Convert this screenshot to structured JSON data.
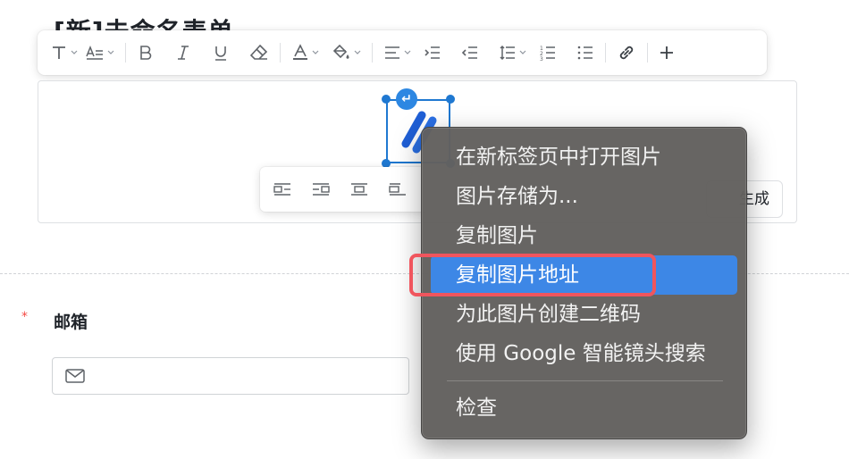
{
  "page": {
    "title": "[新]未命名表单"
  },
  "toolbar": {
    "icons": [
      "text-style-icon",
      "paragraph-style-icon",
      "bold-icon",
      "italic-icon",
      "underline-icon",
      "eraser-icon",
      "font-color-icon",
      "fill-color-icon",
      "align-icon",
      "indent-icon",
      "outdent-icon",
      "line-height-icon",
      "ordered-list-icon",
      "bullet-list-icon",
      "link-icon",
      "plus-icon"
    ]
  },
  "image_align_bar": {
    "icons": [
      "align-left-icon",
      "align-right-icon",
      "align-center-icon",
      "align-inline-icon"
    ]
  },
  "editor": {
    "partial_button_label": "生成"
  },
  "context_menu": {
    "items": [
      {
        "label": "在新标签页中打开图片"
      },
      {
        "label": "图片存储为..."
      },
      {
        "label": "复制图片"
      },
      {
        "label": "复制图片地址",
        "active": true
      },
      {
        "label": "为此图片创建二维码"
      },
      {
        "label": "使用 Google 智能镜头搜索"
      },
      {
        "label": "检查"
      }
    ]
  },
  "form": {
    "email_label": "邮箱",
    "required_mark": "*",
    "email_value": ""
  },
  "colors": {
    "accent": "#1f78d1",
    "menu_bg": "#62605e",
    "menu_active": "#3d87e6",
    "highlight": "#f0555d",
    "required": "#f54a45"
  }
}
